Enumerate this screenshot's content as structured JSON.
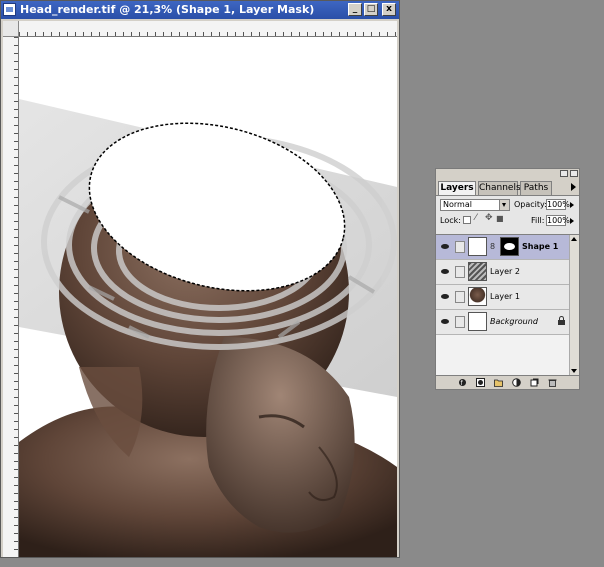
{
  "document": {
    "title": "Head_render.tif @ 21,3% (Shape 1, Layer Mask)",
    "window_buttons": {
      "minimize": "_",
      "maximize": "□",
      "close": "x"
    }
  },
  "layers_panel": {
    "tabs": [
      {
        "label": "Layers",
        "active": true
      },
      {
        "label": "Channels",
        "active": false
      },
      {
        "label": "Paths",
        "active": false
      }
    ],
    "blend_mode": "Normal",
    "opacity_label": "Opacity:",
    "opacity_value": "100%",
    "lock_label": "Lock:",
    "fill_label": "Fill:",
    "fill_value": "100%",
    "layers": [
      {
        "name": "Shape 1",
        "selected": true,
        "has_mask": true,
        "thumb": "white"
      },
      {
        "name": "Layer 2",
        "selected": false,
        "has_mask": false,
        "thumb": "maze"
      },
      {
        "name": "Layer 1",
        "selected": false,
        "has_mask": false,
        "thumb": "head"
      },
      {
        "name": "Background",
        "selected": false,
        "has_mask": false,
        "thumb": "white",
        "locked": true
      }
    ],
    "bottom_icons": [
      "layer-style-icon",
      "add-mask-icon",
      "new-set-icon",
      "adjustment-layer-icon",
      "new-layer-icon",
      "trash-icon"
    ]
  },
  "colors": {
    "workspace": "#8a8a8a",
    "titlebar": "#2a4fa8",
    "selected_layer": "#b7b9d8"
  }
}
